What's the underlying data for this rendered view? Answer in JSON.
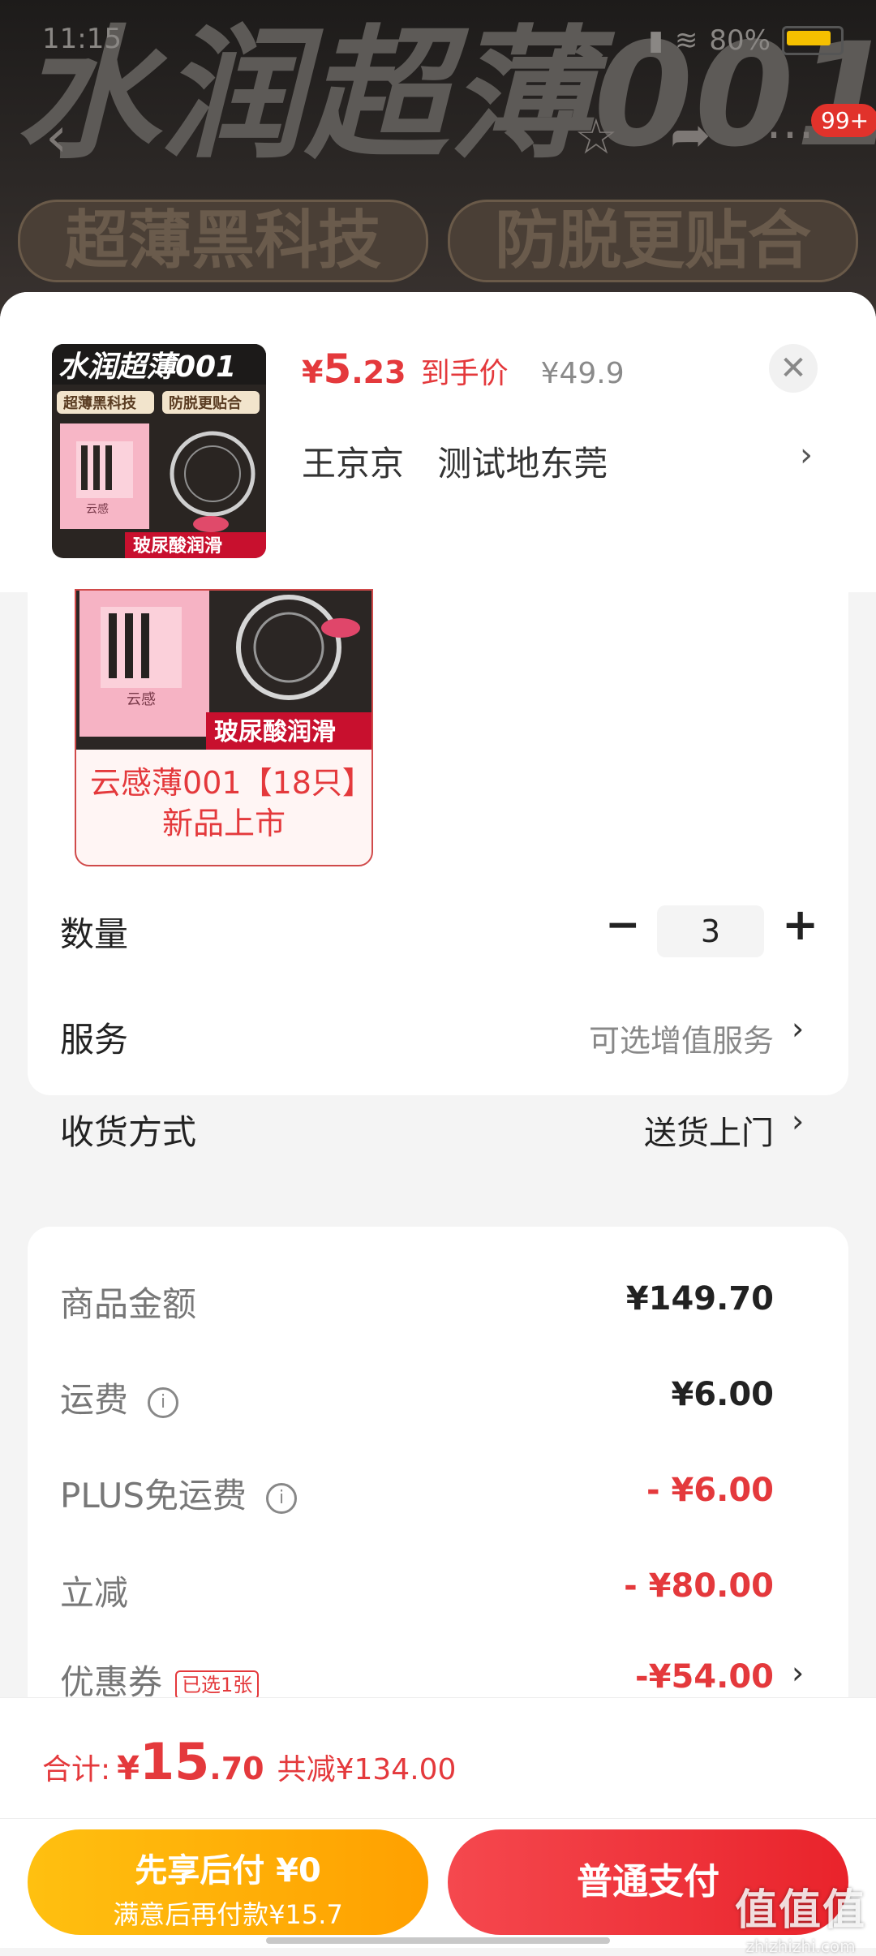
{
  "status_bar": {
    "time": "11:15",
    "battery": "80%"
  },
  "banner": {
    "title": "水润超薄001",
    "tags": [
      "超薄黑科技",
      "防脱更贴合"
    ],
    "cart_badge": "99+"
  },
  "product": {
    "thumb_title": "水润超薄001",
    "thumb_tags": [
      "超薄黑科技",
      "防脱更贴合"
    ],
    "thumb_footer": "玻尿酸润滑",
    "box_brand": "云感",
    "price_yen": "¥",
    "price_int": "5",
    "price_dec": ".23",
    "price_tag": "到手价",
    "original_price": "¥49.9",
    "address_name": "王京京",
    "address_place": "测试地东莞"
  },
  "sku": {
    "footer": "玻尿酸润滑",
    "brand": "云感",
    "name": "云感薄001【18只】新品上市"
  },
  "options": {
    "qty_label": "数量",
    "qty_value": "3",
    "service_label": "服务",
    "service_value": "可选增值服务",
    "delivery_label": "收货方式",
    "delivery_value": "送货上门"
  },
  "summary": {
    "items": [
      {
        "label": "商品金额",
        "value": "¥149.70"
      },
      {
        "label": "运费",
        "value": "¥6.00"
      },
      {
        "label": "PLUS免运费",
        "value": "- ¥6.00"
      },
      {
        "label": "立减",
        "value": "- ¥80.00"
      },
      {
        "label": "优惠券",
        "value": "-¥54.00"
      }
    ],
    "coupon_tag": "已选1张"
  },
  "footer": {
    "total_label": "合计:",
    "total_yen": "¥",
    "total_int": "15",
    "total_dec": ".70",
    "total_save": "共减¥134.00",
    "later_main": "先享后付 ¥0",
    "later_sub": "满意后再付款¥15.7",
    "pay_label": "普通支付"
  },
  "watermark": {
    "main": "值值值",
    "sub": "zhizhizhi.com"
  },
  "colors": {
    "accent_red": "#e4393c",
    "later_gold": "#ffb000"
  }
}
